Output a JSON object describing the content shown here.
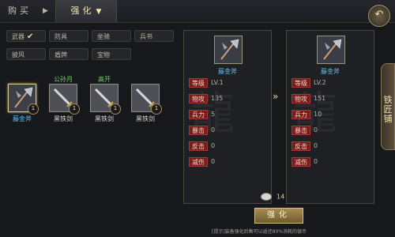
{
  "tabs": {
    "buy": "购买",
    "arrow": "▶",
    "enhance": "强化",
    "enhance_chev": "▼"
  },
  "categories": [
    {
      "label": "武器",
      "checked": true
    },
    {
      "label": "防具",
      "checked": false
    },
    {
      "label": "坐骑",
      "checked": false
    },
    {
      "label": "兵书",
      "checked": false
    },
    {
      "label": "披风",
      "checked": false
    },
    {
      "label": "盾牌",
      "checked": false
    },
    {
      "label": "宝物",
      "checked": false
    }
  ],
  "check_glyph": "✔",
  "items": [
    {
      "owner": "",
      "name": "藤金斧",
      "count": "1",
      "selected": true,
      "icon": "axe-icon"
    },
    {
      "owner": "公孙月",
      "name": "黑铁剑",
      "count": "1",
      "selected": false,
      "icon": "sword-icon"
    },
    {
      "owner": "高开",
      "name": "黑铁剑",
      "count": "1",
      "selected": false,
      "icon": "sword-icon"
    },
    {
      "owner": "",
      "name": "黑铁剑",
      "count": "1",
      "selected": false,
      "icon": "sword-icon"
    }
  ],
  "current": {
    "name": "藤金斧",
    "stats": [
      {
        "label": "等级",
        "value": "LV.1"
      },
      {
        "label": "物攻",
        "value": "135"
      },
      {
        "label": "兵力",
        "value": "5"
      },
      {
        "label": "暴击",
        "value": "0"
      },
      {
        "label": "反击",
        "value": "0"
      },
      {
        "label": "减伤",
        "value": "0"
      }
    ]
  },
  "next": {
    "name": "藤金斧",
    "stats": [
      {
        "label": "等级",
        "value": "LV.2"
      },
      {
        "label": "物攻",
        "value": "151"
      },
      {
        "label": "兵力",
        "value": "10"
      },
      {
        "label": "暴击",
        "value": "0"
      },
      {
        "label": "反击",
        "value": "0"
      },
      {
        "label": "减伤",
        "value": "0"
      }
    ]
  },
  "side_tab": "铁匠铺",
  "cost": "14",
  "enhance_button": "强化",
  "hint": "[提示]装备强化后售可以返还80%消耗的银币",
  "colors": {
    "accent": "#d8c283",
    "stat_label_bg": "#7a1c1c",
    "item_name_blue": "#6ab8e6",
    "owner_green": "#6fcf66"
  }
}
